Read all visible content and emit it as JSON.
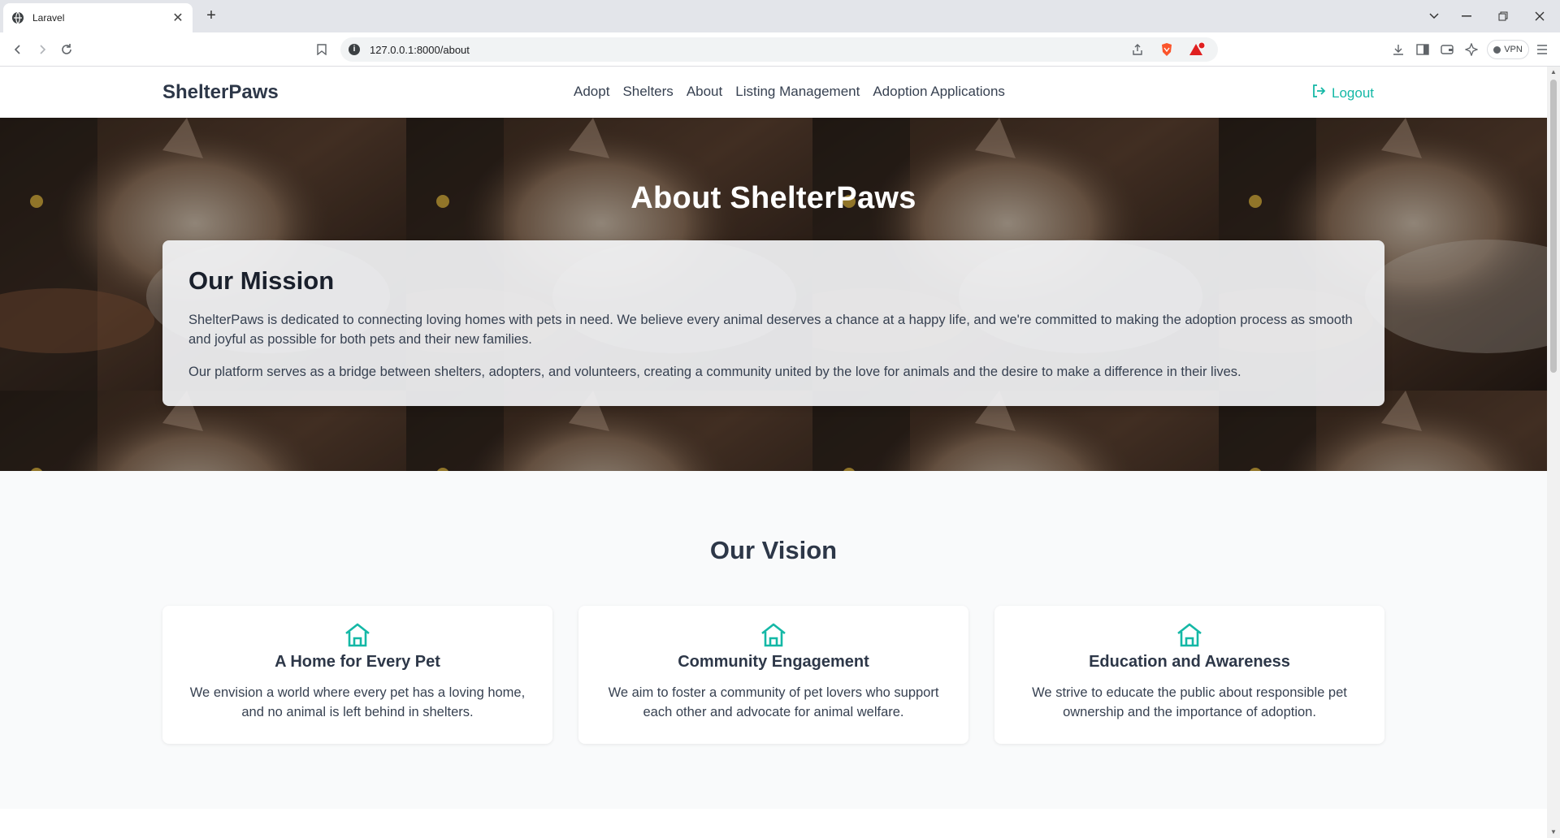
{
  "browser": {
    "tab_title": "Laravel",
    "tab_close": "✕",
    "new_tab": "+",
    "url": "127.0.0.1:8000/about",
    "info_glyph": "i",
    "notification_count": "1",
    "vpn_label": "VPN"
  },
  "nav": {
    "brand": "ShelterPaws",
    "links": [
      "Adopt",
      "Shelters",
      "About",
      "Listing Management",
      "Adoption Applications"
    ],
    "logout": "Logout"
  },
  "hero": {
    "title": "About ShelterPaws",
    "mission": {
      "heading": "Our Mission",
      "paragraphs": [
        "ShelterPaws is dedicated to connecting loving homes with pets in need. We believe every animal deserves a chance at a happy life, and we're committed to making the adoption process as smooth and joyful as possible for both pets and their new families.",
        "Our platform serves as a bridge between shelters, adopters, and volunteers, creating a community united by the love for animals and the desire to make a difference in their lives."
      ]
    }
  },
  "vision": {
    "heading": "Our Vision",
    "cards": [
      {
        "icon": "home-icon",
        "title": "A Home for Every Pet",
        "text": "We envision a world where every pet has a loving home, and no animal is left behind in shelters."
      },
      {
        "icon": "home-icon",
        "title": "Community Engagement",
        "text": "We aim to foster a community of pet lovers who support each other and advocate for animal welfare."
      },
      {
        "icon": "home-icon",
        "title": "Education and Awareness",
        "text": "We strive to educate the public about responsible pet ownership and the importance of adoption."
      }
    ]
  },
  "colors": {
    "accent": "#14b8a6",
    "brand_text": "#2d3748",
    "hero_dark": "#2a1e17"
  }
}
